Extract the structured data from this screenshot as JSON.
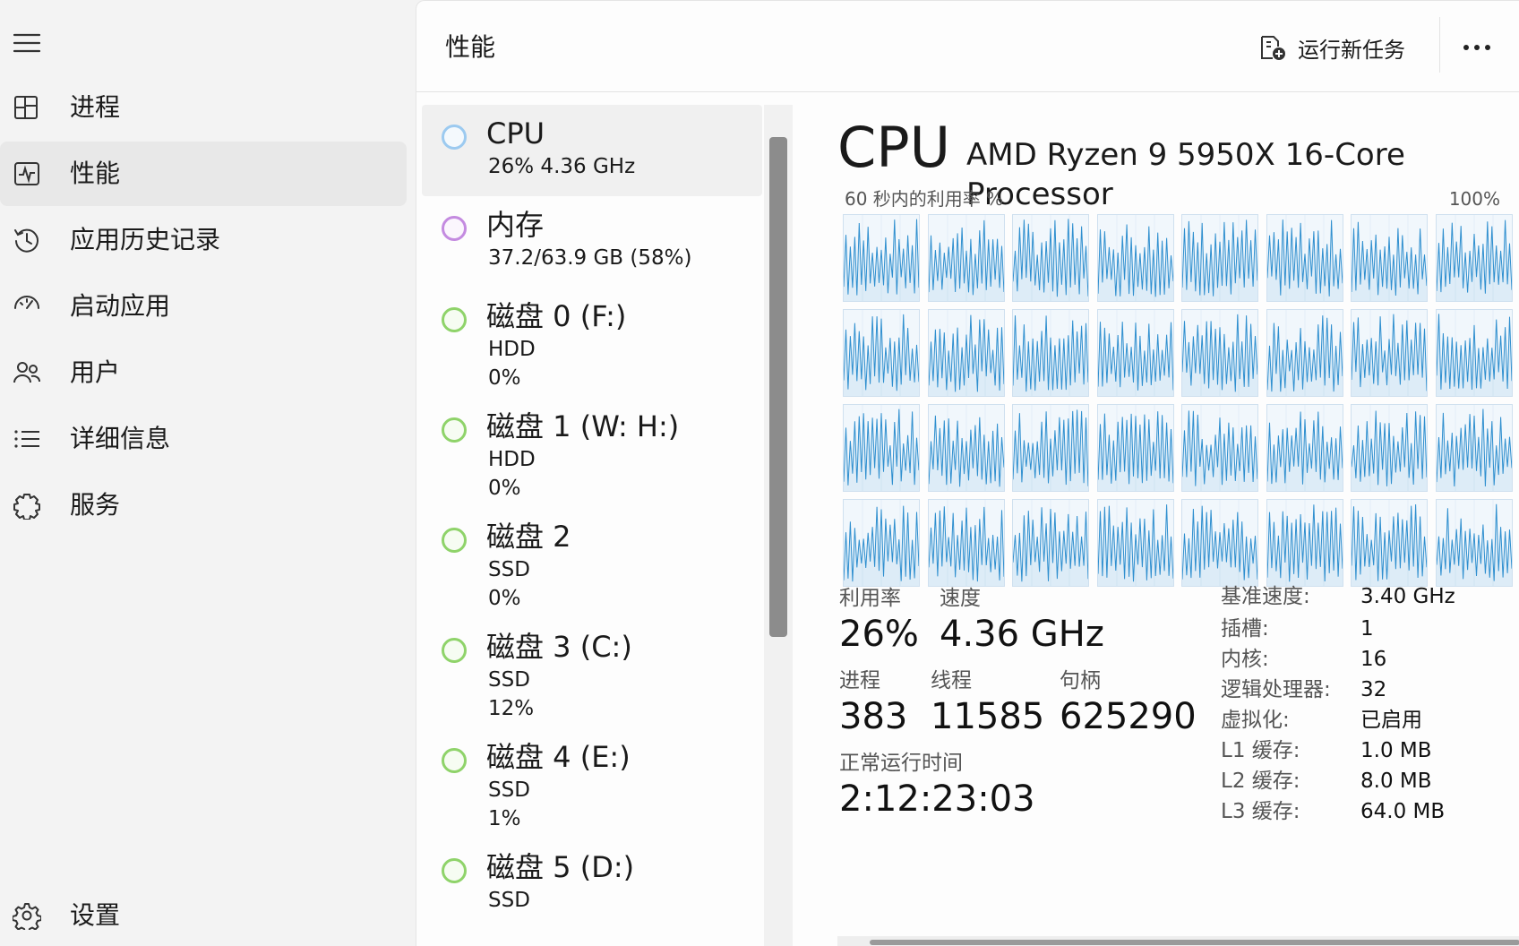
{
  "nav": {
    "items": [
      {
        "id": "processes",
        "label": "进程",
        "icon": "processes-icon"
      },
      {
        "id": "performance",
        "label": "性能",
        "icon": "performance-icon",
        "active": true
      },
      {
        "id": "app-history",
        "label": "应用历史记录",
        "icon": "history-icon"
      },
      {
        "id": "startup",
        "label": "启动应用",
        "icon": "startup-icon"
      },
      {
        "id": "users",
        "label": "用户",
        "icon": "users-icon"
      },
      {
        "id": "details",
        "label": "详细信息",
        "icon": "details-icon"
      },
      {
        "id": "services",
        "label": "服务",
        "icon": "services-icon"
      }
    ],
    "settings_label": "设置"
  },
  "header": {
    "title": "性能",
    "run_task_label": "运行新任务"
  },
  "devices": [
    {
      "name": "CPU",
      "line1": "26%  4.36 GHz",
      "line2": "",
      "kind": "cpu"
    },
    {
      "name": "内存",
      "line1": "37.2/63.9 GB (58%)",
      "line2": "",
      "kind": "mem"
    },
    {
      "name": "磁盘 0 (F:)",
      "line1": "HDD",
      "line2": "0%",
      "kind": "disk"
    },
    {
      "name": "磁盘 1 (W: H:)",
      "line1": "HDD",
      "line2": "0%",
      "kind": "disk"
    },
    {
      "name": "磁盘 2",
      "line1": "SSD",
      "line2": "0%",
      "kind": "disk"
    },
    {
      "name": "磁盘 3 (C:)",
      "line1": "SSD",
      "line2": "12%",
      "kind": "disk"
    },
    {
      "name": "磁盘 4 (E:)",
      "line1": "SSD",
      "line2": "1%",
      "kind": "disk"
    },
    {
      "name": "磁盘 5 (D:)",
      "line1": "SSD",
      "line2": "",
      "kind": "disk"
    }
  ],
  "cpu": {
    "title": "CPU",
    "model": "AMD Ryzen 9 5950X 16-Core Processor",
    "graph_label": "60 秒内的利用率 %",
    "graph_max": "100%",
    "logical_processors": 32,
    "graph_color": "#2f8fcf",
    "stats": {
      "utilization_label": "利用率",
      "utilization": "26%",
      "speed_label": "速度",
      "speed": "4.36 GHz",
      "processes_label": "进程",
      "processes": "383",
      "threads_label": "线程",
      "threads": "11585",
      "handles_label": "句柄",
      "handles": "625290",
      "uptime_label": "正常运行时间",
      "uptime": "2:12:23:03"
    },
    "specs": [
      {
        "label": "基准速度:",
        "value": "3.40 GHz"
      },
      {
        "label": "插槽:",
        "value": "1"
      },
      {
        "label": "内核:",
        "value": "16"
      },
      {
        "label": "逻辑处理器:",
        "value": "32"
      },
      {
        "label": "虚拟化:",
        "value": "已启用"
      },
      {
        "label": "L1 缓存:",
        "value": "1.0 MB"
      },
      {
        "label": "L2 缓存:",
        "value": "8.0 MB"
      },
      {
        "label": "L3 缓存:",
        "value": "64.0 MB"
      }
    ]
  }
}
